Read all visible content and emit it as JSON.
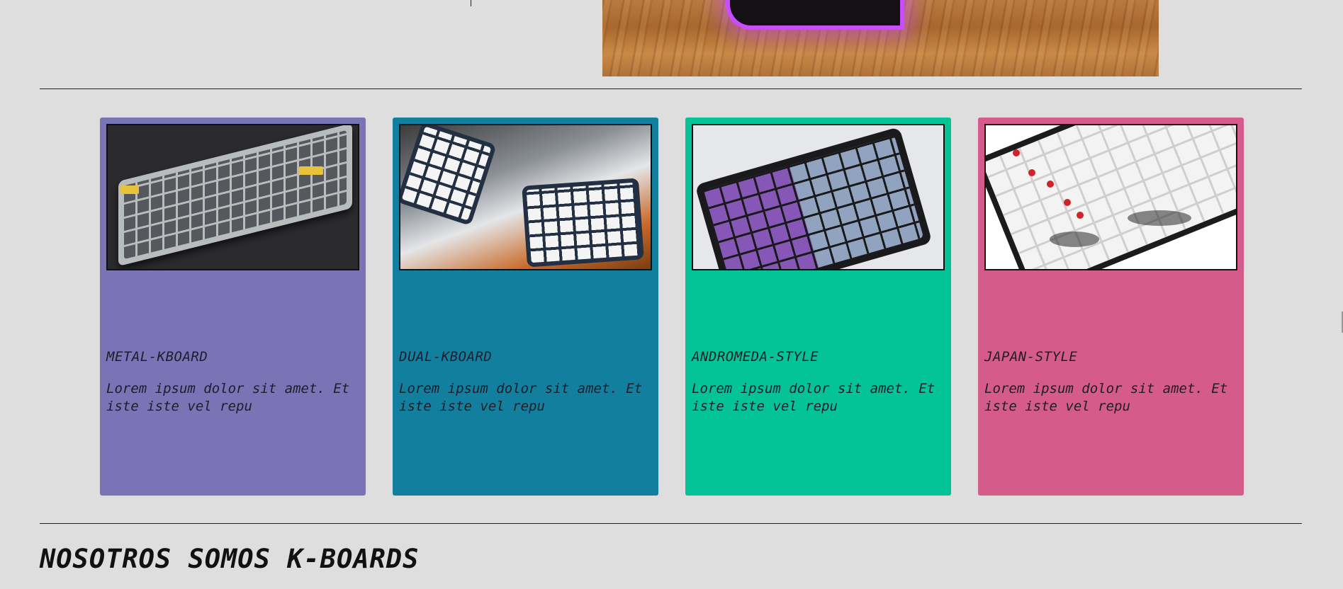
{
  "hero": {
    "image_desc": "keyboard-neon-on-wood"
  },
  "cards": [
    {
      "title": "METAL-KBOARD",
      "description": "Lorem ipsum dolor sit amet. Et iste iste vel repu",
      "color": "#7a73b6",
      "image": "metal-keyboard-photo"
    },
    {
      "title": "DUAL-KBOARD",
      "description": "Lorem ipsum dolor sit amet. Et iste iste vel repu",
      "color": "#137f9e",
      "image": "split-keyboard-photo"
    },
    {
      "title": "ANDROMEDA-STYLE",
      "description": "Lorem ipsum dolor sit amet. Et iste iste vel repu",
      "color": "#03c397",
      "image": "andromeda-keyboard-photo"
    },
    {
      "title": "JAPAN-STYLE",
      "description": "Lorem ipsum dolor sit amet. Et iste iste vel repu",
      "color": "#d55b8b",
      "image": "japan-keyboard-photo"
    }
  ],
  "about": {
    "heading": "NOSOTROS SOMOS K-BOARDS"
  }
}
